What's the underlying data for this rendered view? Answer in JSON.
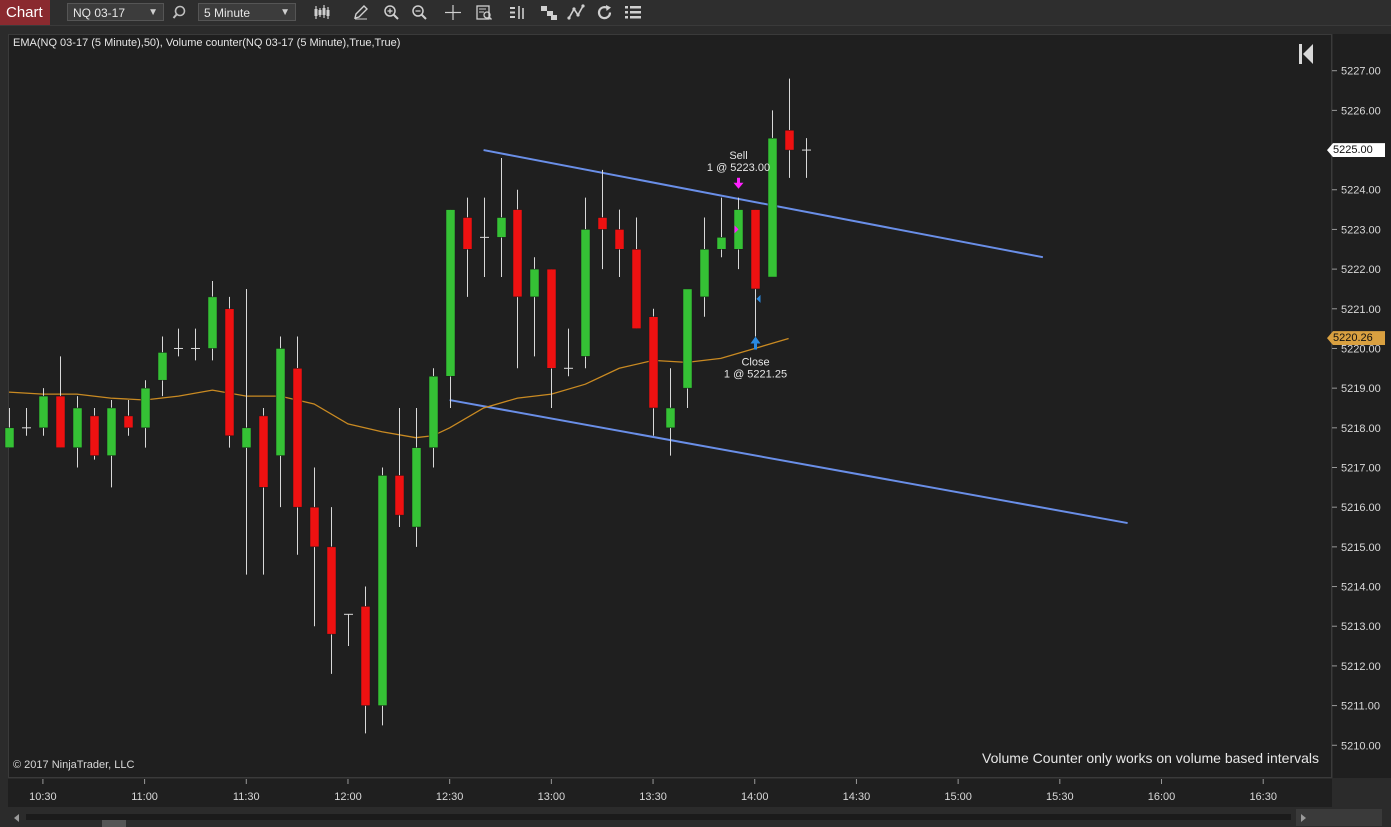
{
  "toolbar": {
    "chart_tab": "Chart",
    "instrument": "NQ 03-17",
    "interval": "5 Minute"
  },
  "chart_info": {
    "indicator_label": "EMA(NQ 03-17 (5 Minute),50), Volume counter(NQ 03-17 (5 Minute),True,True)",
    "copyright": "© 2017 NinjaTrader, LLC",
    "volume_counter_message": "Volume Counter only works on volume based intervals"
  },
  "colors": {
    "up": "#35c135",
    "down": "#ee1111",
    "ema": "#c98a22",
    "trendline": "#6a8fe8",
    "sell_marker": "#ff22ff",
    "close_marker": "#2a8ae0",
    "last_price_tag": "#ffffff",
    "ema_tag": "#d9a040"
  },
  "chart_data": {
    "type": "candlestick",
    "interval_minutes": 5,
    "x_tick_labels": [
      "10:30",
      "11:00",
      "11:30",
      "12:00",
      "12:30",
      "13:00",
      "13:30",
      "14:00",
      "14:30",
      "15:00",
      "15:30",
      "16:00",
      "16:30"
    ],
    "y_tick_labels": [
      "5210.00",
      "5211.00",
      "5212.00",
      "5213.00",
      "5214.00",
      "5215.00",
      "5216.00",
      "5217.00",
      "5218.00",
      "5219.00",
      "5220.00",
      "5221.00",
      "5222.00",
      "5223.00",
      "5224.00",
      "5225.00",
      "5226.00",
      "5227.00"
    ],
    "xlim": [
      "10:20",
      "16:50"
    ],
    "ylim": [
      5209.2,
      5227.9
    ],
    "candles": [
      {
        "time": "10:20",
        "open": 5217.5,
        "high": 5218.5,
        "low": 5217.5,
        "close": 5218.0
      },
      {
        "time": "10:25",
        "open": 5218.0,
        "high": 5218.5,
        "low": 5217.8,
        "close": 5218.0
      },
      {
        "time": "10:30",
        "open": 5218.0,
        "high": 5219.0,
        "low": 5217.8,
        "close": 5218.8
      },
      {
        "time": "10:35",
        "open": 5218.8,
        "high": 5219.8,
        "low": 5217.5,
        "close": 5217.5
      },
      {
        "time": "10:40",
        "open": 5217.5,
        "high": 5218.8,
        "low": 5217.0,
        "close": 5218.5
      },
      {
        "time": "10:45",
        "open": 5218.3,
        "high": 5218.5,
        "low": 5217.2,
        "close": 5217.3
      },
      {
        "time": "10:50",
        "open": 5217.3,
        "high": 5218.7,
        "low": 5216.5,
        "close": 5218.5
      },
      {
        "time": "10:55",
        "open": 5218.3,
        "high": 5218.7,
        "low": 5217.8,
        "close": 5218.0
      },
      {
        "time": "11:00",
        "open": 5218.0,
        "high": 5219.2,
        "low": 5217.5,
        "close": 5219.0
      },
      {
        "time": "11:05",
        "open": 5219.2,
        "high": 5220.3,
        "low": 5218.8,
        "close": 5219.9
      },
      {
        "time": "11:10",
        "open": 5220.0,
        "high": 5220.5,
        "low": 5219.8,
        "close": 5220.0
      },
      {
        "time": "11:15",
        "open": 5220.0,
        "high": 5220.5,
        "low": 5219.7,
        "close": 5220.0
      },
      {
        "time": "11:20",
        "open": 5220.0,
        "high": 5221.7,
        "low": 5219.7,
        "close": 5221.3
      },
      {
        "time": "11:25",
        "open": 5221.0,
        "high": 5221.3,
        "low": 5217.5,
        "close": 5217.8
      },
      {
        "time": "11:30",
        "open": 5217.5,
        "high": 5221.5,
        "low": 5214.3,
        "close": 5218.0
      },
      {
        "time": "11:35",
        "open": 5218.3,
        "high": 5218.5,
        "low": 5214.3,
        "close": 5216.5
      },
      {
        "time": "11:40",
        "open": 5217.3,
        "high": 5220.3,
        "low": 5216.0,
        "close": 5220.0
      },
      {
        "time": "11:45",
        "open": 5219.5,
        "high": 5220.3,
        "low": 5214.8,
        "close": 5216.0
      },
      {
        "time": "11:50",
        "open": 5216.0,
        "high": 5217.0,
        "low": 5213.0,
        "close": 5215.0
      },
      {
        "time": "11:55",
        "open": 5215.0,
        "high": 5216.0,
        "low": 5211.8,
        "close": 5212.8
      },
      {
        "time": "12:00",
        "open": 5213.3,
        "high": 5213.3,
        "low": 5212.5,
        "close": 5213.3
      },
      {
        "time": "12:05",
        "open": 5213.5,
        "high": 5214.0,
        "low": 5210.3,
        "close": 5211.0
      },
      {
        "time": "12:10",
        "open": 5211.0,
        "high": 5217.0,
        "low": 5210.5,
        "close": 5216.8
      },
      {
        "time": "12:15",
        "open": 5216.8,
        "high": 5218.5,
        "low": 5215.5,
        "close": 5215.8
      },
      {
        "time": "12:20",
        "open": 5215.5,
        "high": 5218.5,
        "low": 5215.0,
        "close": 5217.5
      },
      {
        "time": "12:25",
        "open": 5217.5,
        "high": 5219.5,
        "low": 5217.0,
        "close": 5219.3
      },
      {
        "time": "12:30",
        "open": 5219.3,
        "high": 5223.5,
        "low": 5218.5,
        "close": 5223.5
      },
      {
        "time": "12:35",
        "open": 5223.3,
        "high": 5223.8,
        "low": 5221.3,
        "close": 5222.5
      },
      {
        "time": "12:40",
        "open": 5222.8,
        "high": 5223.8,
        "low": 5221.8,
        "close": 5222.8
      },
      {
        "time": "12:45",
        "open": 5222.8,
        "high": 5224.8,
        "low": 5221.8,
        "close": 5223.3
      },
      {
        "time": "12:50",
        "open": 5223.5,
        "high": 5224.0,
        "low": 5219.5,
        "close": 5221.3
      },
      {
        "time": "12:55",
        "open": 5221.3,
        "high": 5222.3,
        "low": 5219.8,
        "close": 5222.0
      },
      {
        "time": "13:00",
        "open": 5222.0,
        "high": 5222.0,
        "low": 5218.5,
        "close": 5219.5
      },
      {
        "time": "13:05",
        "open": 5219.5,
        "high": 5220.5,
        "low": 5219.3,
        "close": 5219.5
      },
      {
        "time": "13:10",
        "open": 5219.8,
        "high": 5223.8,
        "low": 5219.5,
        "close": 5223.0
      },
      {
        "time": "13:15",
        "open": 5223.3,
        "high": 5224.5,
        "low": 5222.0,
        "close": 5223.0
      },
      {
        "time": "13:20",
        "open": 5223.0,
        "high": 5223.5,
        "low": 5221.8,
        "close": 5222.5
      },
      {
        "time": "13:25",
        "open": 5222.5,
        "high": 5223.3,
        "low": 5220.5,
        "close": 5220.5
      },
      {
        "time": "13:30",
        "open": 5220.8,
        "high": 5221.0,
        "low": 5217.8,
        "close": 5218.5
      },
      {
        "time": "13:35",
        "open": 5218.0,
        "high": 5219.5,
        "low": 5217.3,
        "close": 5218.5
      },
      {
        "time": "13:40",
        "open": 5219.0,
        "high": 5221.5,
        "low": 5218.5,
        "close": 5221.5
      },
      {
        "time": "13:45",
        "open": 5221.3,
        "high": 5223.3,
        "low": 5220.8,
        "close": 5222.5
      },
      {
        "time": "13:50",
        "open": 5222.5,
        "high": 5223.8,
        "low": 5222.3,
        "close": 5222.8
      },
      {
        "time": "13:55",
        "open": 5222.5,
        "high": 5223.8,
        "low": 5222.0,
        "close": 5223.5
      },
      {
        "time": "14:00",
        "open": 5223.5,
        "high": 5223.5,
        "low": 5220.3,
        "close": 5221.5
      },
      {
        "time": "14:05",
        "open": 5221.8,
        "high": 5226.0,
        "low": 5221.8,
        "close": 5225.3
      },
      {
        "time": "14:10",
        "open": 5225.5,
        "high": 5226.8,
        "low": 5224.3,
        "close": 5225.0
      },
      {
        "time": "14:15",
        "open": 5225.0,
        "high": 5225.3,
        "low": 5224.3,
        "close": 5225.0
      }
    ],
    "series": [
      {
        "kind": "ema",
        "points": [
          [
            "10:20",
            5218.9
          ],
          [
            "10:30",
            5218.85
          ],
          [
            "10:40",
            5218.85
          ],
          [
            "10:50",
            5218.75
          ],
          [
            "11:00",
            5218.7
          ],
          [
            "11:10",
            5218.8
          ],
          [
            "11:20",
            5218.95
          ],
          [
            "11:30",
            5218.8
          ],
          [
            "11:40",
            5218.8
          ],
          [
            "11:50",
            5218.6
          ],
          [
            "12:00",
            5218.1
          ],
          [
            "12:10",
            5217.9
          ],
          [
            "12:20",
            5217.75
          ],
          [
            "12:25",
            5217.8
          ],
          [
            "12:30",
            5218.0
          ],
          [
            "12:40",
            5218.5
          ],
          [
            "12:50",
            5218.75
          ],
          [
            "13:00",
            5218.85
          ],
          [
            "13:10",
            5219.1
          ],
          [
            "13:20",
            5219.5
          ],
          [
            "13:30",
            5219.7
          ],
          [
            "13:40",
            5219.65
          ],
          [
            "13:50",
            5219.75
          ],
          [
            "14:00",
            5220.0
          ],
          [
            "14:10",
            5220.25
          ]
        ]
      }
    ],
    "trendlines": [
      {
        "from": [
          "12:40",
          5225.0
        ],
        "to": [
          "15:25",
          5222.3
        ]
      },
      {
        "from": [
          "12:30",
          5218.7
        ],
        "to": [
          "15:50",
          5215.6
        ]
      }
    ],
    "markers": [
      {
        "type": "sell",
        "time": "13:55",
        "price": 5223.0,
        "label": "Sell",
        "detail": "1 @ 5223.00"
      },
      {
        "type": "close",
        "time": "14:00",
        "price": 5221.25,
        "label": "Close",
        "detail": "1 @ 5221.25"
      }
    ],
    "price_tags": [
      {
        "label": "5225.00",
        "price": 5225.0,
        "kind": "last"
      },
      {
        "label": "5220.26",
        "price": 5220.26,
        "kind": "ema"
      }
    ]
  }
}
